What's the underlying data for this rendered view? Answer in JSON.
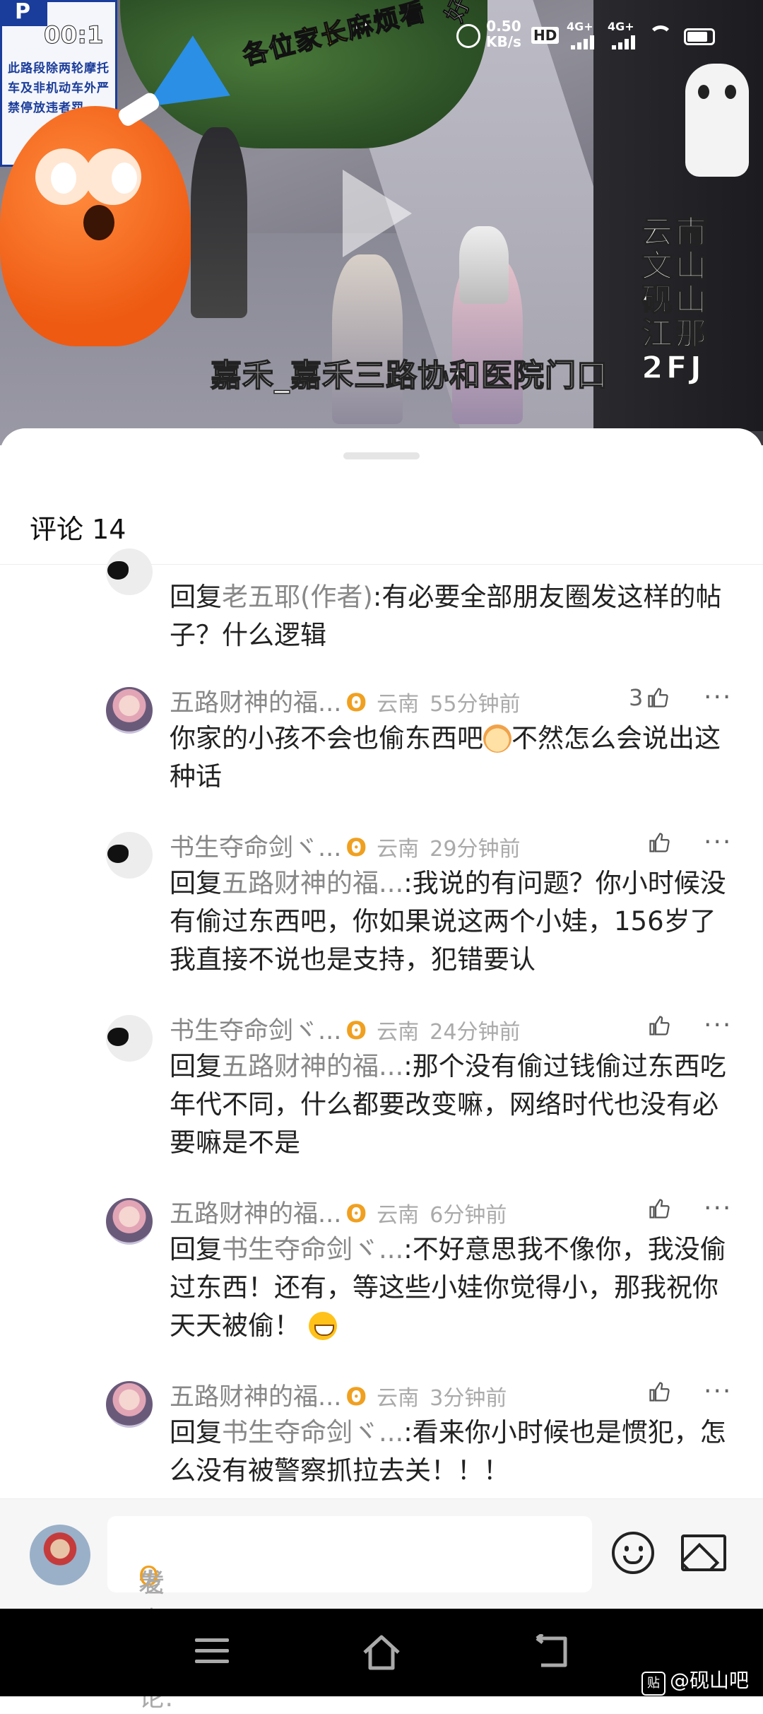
{
  "video": {
    "play_label": "Play",
    "overlay_partial": "好",
    "overlay_title_prefix": "各位",
    "overlay_title_highlight": "家长",
    "overlay_title_suffix": "麻烦看",
    "location_caption": "嘉禾_嘉禾三路协和医院门口",
    "region_tag": "云南文山砚山江那2FJ",
    "sign_text": "此路段除两轮摩托车及非机动车外严禁停放违者罚",
    "sign_letter": "P"
  },
  "status_bar": {
    "time": "00:1",
    "net_speed_value": "0.50",
    "net_speed_unit": "KB/s",
    "hd_label": "HD",
    "sim1_label": "4G+",
    "sim2_label": "4G+"
  },
  "comments_panel": {
    "title": "评论 14",
    "comments": [
      {
        "avatar": "sheep-avatar",
        "body_prefix": "回复",
        "reply_to": "老五耶(作者)",
        "body": ":有必要全部朋友圈发这样的帖子？什么逻辑"
      },
      {
        "avatar": "girl-avatar",
        "username": "五路财神的福...",
        "badge": "ʘ",
        "location": "云南",
        "time": "55分钟前",
        "likes": "3",
        "more": "···",
        "body": "你家的小孩不会也偷东西吧",
        "body_after_emoji": "不然怎么会说出这种话"
      },
      {
        "avatar": "sheep-avatar",
        "username": "书生夺命剑ヾ...",
        "badge": "ʘ",
        "location": "云南",
        "time": "29分钟前",
        "likes": "",
        "more": "···",
        "body_prefix": "回复",
        "reply_to": "五路财神的福...",
        "body": ":我说的有问题？你小时候没有偷过东西吧，你如果说这两个小娃，156岁了我直接不说也是支持，犯错要认"
      },
      {
        "avatar": "sheep-avatar",
        "username": "书生夺命剑ヾ...",
        "badge": "ʘ",
        "location": "云南",
        "time": "24分钟前",
        "likes": "",
        "more": "···",
        "body_prefix": "回复",
        "reply_to": "五路财神的福...",
        "body": ":那个没有偷过钱偷过东西吃年代不同，什么都要改变嘛，网络时代也没有必要嘛是不是"
      },
      {
        "avatar": "girl-avatar",
        "username": "五路财神的福...",
        "badge": "ʘ",
        "location": "云南",
        "time": "6分钟前",
        "likes": "",
        "more": "···",
        "body_prefix": "回复",
        "reply_to": "书生夺命剑ヾ...",
        "body": ":不好意思我不像你，我没偷过东西！还有，等这些小娃你觉得小，那我祝你天天被偷！"
      },
      {
        "avatar": "girl-avatar",
        "username": "五路财神的福...",
        "badge": "ʘ",
        "location": "云南",
        "time": "3分钟前",
        "likes": "",
        "more": "···",
        "body_prefix": "回复",
        "reply_to": "书生夺命剑ヾ...",
        "body": ":看来你小时候也是惯犯，怎么没有被警察抓拉去关！！！"
      }
    ]
  },
  "input_bar": {
    "user_name": "老五耶",
    "badge": "ʘ",
    "placeholder": "发表评论:",
    "emoji_icon": "emoji-icon",
    "image_icon": "image-icon"
  },
  "nav_bar": {
    "watermark_logo": "贴",
    "watermark": "@砚山吧"
  },
  "colors": {
    "badge": "#f0a020",
    "muted": "#888888",
    "overlay_highlight": "#ffd400"
  }
}
